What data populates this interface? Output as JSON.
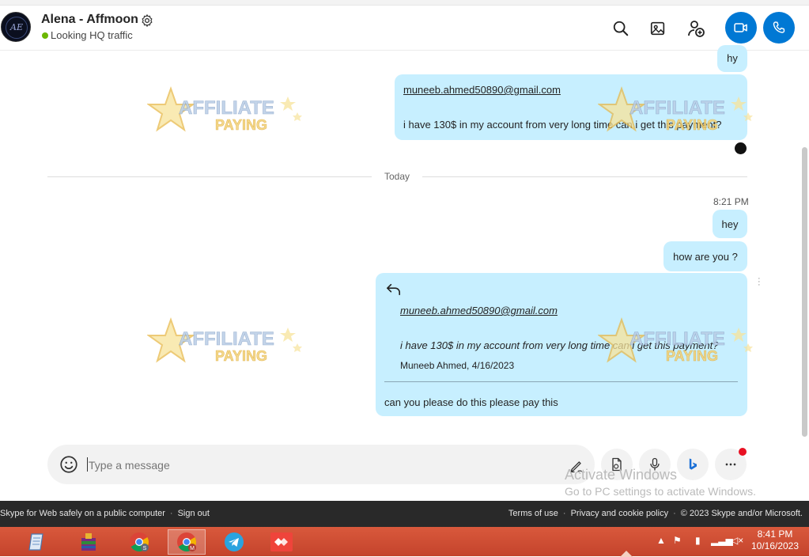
{
  "header": {
    "avatar_initials": "AE",
    "title": "Alena - Affmoon",
    "status": "Looking HQ traffic"
  },
  "watermark": {
    "line1": "AFFILIATE",
    "line2": "PAYING"
  },
  "messages": {
    "hy": "hy",
    "email1": "muneeb.ahmed50890@gmail.com",
    "text1": "i have 130$ in my account from very long time  can i get this payment?",
    "today": "Today",
    "time": "8:21 PM",
    "hey": "hey",
    "how": "how are you ?",
    "quote_email": "muneeb.ahmed50890@gmail.com",
    "quote_text": "i have 130$ in my account from very long time  can i get this payment?",
    "quote_author": "Muneeb Ahmed, 4/16/2023",
    "reply": "can you please do this please pay this"
  },
  "composer": {
    "placeholder": "Type a message"
  },
  "activate": {
    "line1": "Activate Windows",
    "line2": "Go to PC settings to activate Windows."
  },
  "footer": {
    "left_text": "Skype for Web safely on a public computer",
    "sign_out": "Sign out",
    "terms": "Terms of use",
    "privacy": "Privacy and cookie policy",
    "copyright": "© 2023 Skype and/or Microsoft."
  },
  "taskbar": {
    "time": "8:41 PM",
    "date": "10/16/2023"
  },
  "colors": {
    "bubble": "#c7efff",
    "accent": "#0078d4",
    "online": "#6bb700",
    "taskbar": "#cf4e33"
  }
}
